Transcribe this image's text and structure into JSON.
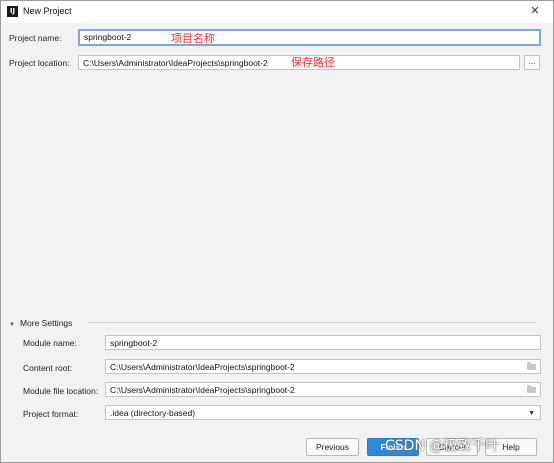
{
  "window": {
    "title": "New Project",
    "icon": "intellij-logo-icon",
    "icon_text": "IJ",
    "close_glyph": "✕"
  },
  "project": {
    "name_label": "Project name:",
    "name_value": "springboot-2",
    "name_annotation": "项目名称",
    "location_label": "Project location:",
    "location_value": "C:\\Users\\Administrator\\IdeaProjects\\springboot-2",
    "location_annotation": "保存路径",
    "browse_label": "..."
  },
  "more_settings": {
    "toggle_label": "More Settings",
    "toggle_glyph": "▼",
    "module_name_label": "Module name:",
    "module_name_value": "springboot-2",
    "content_root_label": "Content root:",
    "content_root_value": "C:\\Users\\Administrator\\IdeaProjects\\springboot-2",
    "module_file_label": "Module file location:",
    "module_file_value": "C:\\Users\\Administrator\\IdeaProjects\\springboot-2",
    "format_label": "Project format:",
    "format_value": ".idea (directory-based)",
    "format_chevron": "▼"
  },
  "footer": {
    "previous": "Previous",
    "finish": "Finish",
    "cancel": "Cancel",
    "help": "Help"
  },
  "watermark": "CSDN @极致千叶",
  "colors": {
    "accent": "#2e8ad8",
    "annotation": "#ff2a2a",
    "focus_border": "#7aa9d8",
    "background": "#f2f2f2"
  }
}
